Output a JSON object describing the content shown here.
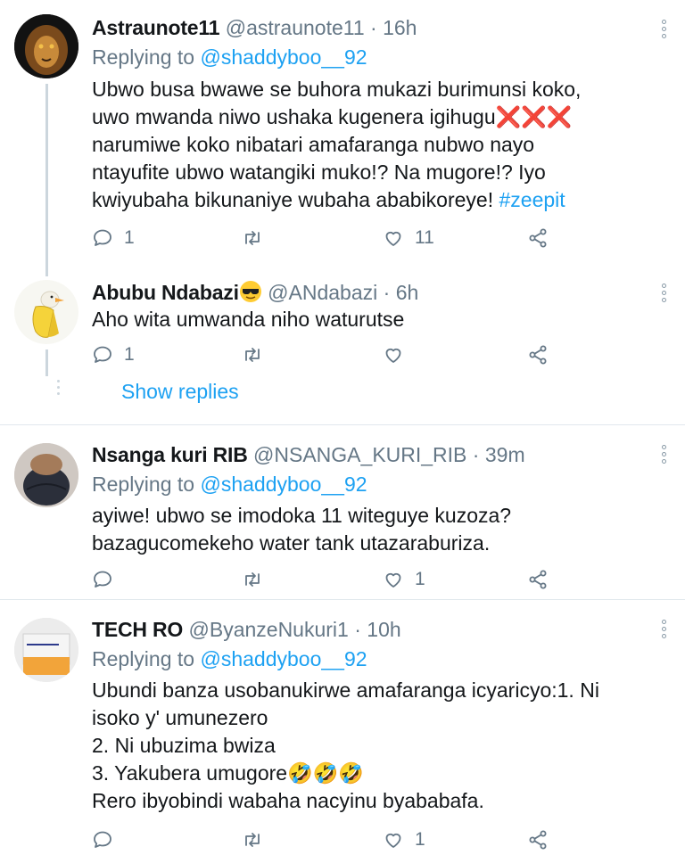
{
  "tweets": [
    {
      "name": "Astraunote11",
      "handle": "@astraunote11",
      "separator": "·",
      "time": "16h",
      "replying_prefix": "Replying to",
      "replying_to": "@shaddyboo__92",
      "lines": [
        "Ubwo busa bwawe se buhora mukazi burimunsi koko,",
        "uwo mwanda niwo ushaka kugenera igihugu",
        "narumiwe koko nibatari amafaranga nubwo nayo",
        "ntayufite ubwo watangiki muko!? Na mugore!? Iyo",
        "kwiyubaha bikunaniye wubaha ababikoreye!"
      ],
      "emoji_after_line2": "❌❌❌",
      "hashtag": "#zeepit",
      "reply_count": "1",
      "retweet_count": "",
      "like_count": "11"
    },
    {
      "name": "Abubu Ndabazi",
      "name_emoji": "😎",
      "handle": "@ANdabazi",
      "separator": "·",
      "time": "6h",
      "lines": [
        "Aho wita umwanda niho waturutse"
      ],
      "reply_count": "1",
      "retweet_count": "",
      "like_count": ""
    },
    {
      "name": "Nsanga kuri RIB",
      "handle": "@NSANGA_KURI_RIB",
      "separator": "·",
      "time": "39m",
      "replying_prefix": "Replying to",
      "replying_to": "@shaddyboo__92",
      "lines": [
        "ayiwe! ubwo se imodoka 11 witeguye kuzoza?",
        "bazagucomekeho water tank utazaraburiza."
      ],
      "reply_count": "",
      "retweet_count": "",
      "like_count": "1"
    },
    {
      "name": "TECH RO",
      "handle": "@ByanzeNukuri1",
      "separator": "·",
      "time": "10h",
      "replying_prefix": "Replying to",
      "replying_to": "@shaddyboo__92",
      "lines": [
        "Ubundi banza usobanukirwe amafaranga icyaricyo:1. Ni",
        "isoko y' umunezero",
        "2. Ni ubuzima bwiza",
        "3.  Yakubera umugore",
        "Rero ibyobindi wabaha nacyinu byababafa."
      ],
      "emoji_after_line4": "🤣🤣🤣",
      "reply_count": "",
      "retweet_count": "",
      "like_count": "1"
    }
  ],
  "show_replies": "Show replies",
  "icons": {
    "reply": "reply-icon",
    "retweet": "retweet-icon",
    "like": "heart-icon",
    "share": "share-icon",
    "more": "more-vertical-icon"
  },
  "colors": {
    "accent": "#1da1f2",
    "muted": "#657786",
    "text": "#14171a",
    "divider": "#e1e8ed"
  }
}
